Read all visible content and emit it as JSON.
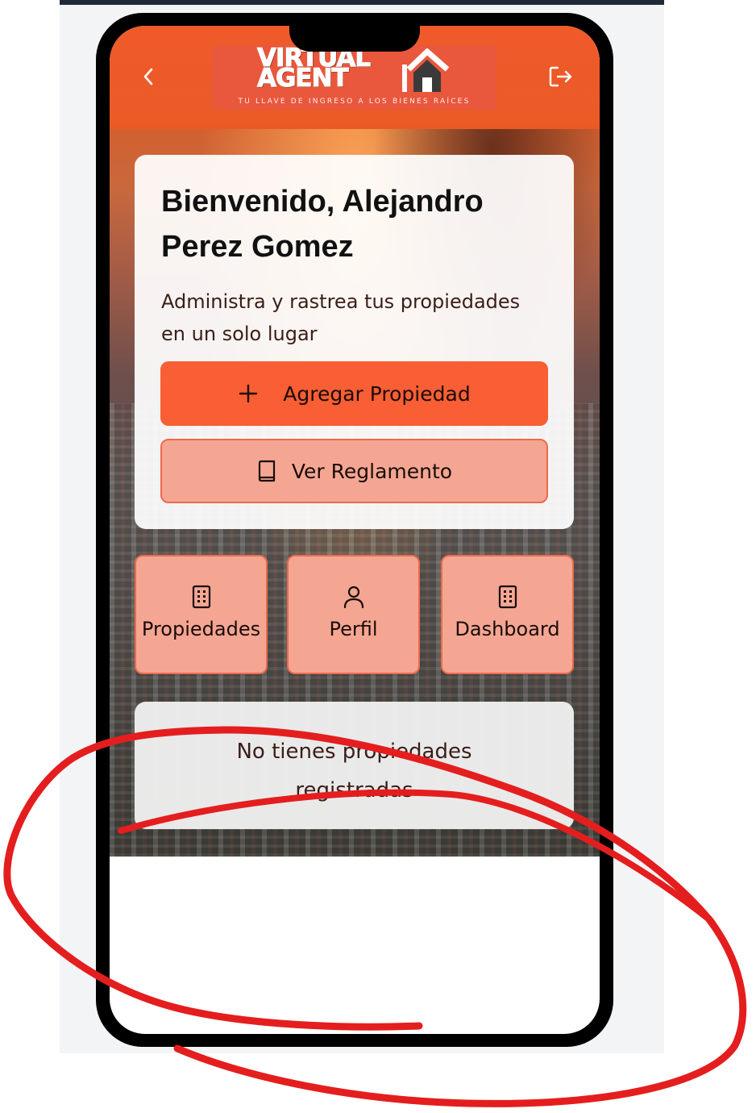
{
  "header": {
    "back_icon": "chevron-left-icon",
    "logout_icon": "logout-icon",
    "logo": {
      "line1": "VIRTUAL",
      "line2": "AGENT",
      "tagline": "TU LLAVE DE INGRESO A LOS BIENES RAÍCES"
    }
  },
  "welcome": {
    "title": "Bienvenido, Alejandro Perez Gomez",
    "subtitle": "Administra y rastrea tus propiedades en un solo lugar",
    "add_button": "Agregar Propiedad",
    "rules_button": "Ver Reglamento"
  },
  "tiles": [
    {
      "label": "Propiedades",
      "icon": "building-icon"
    },
    {
      "label": "Perfil",
      "icon": "user-icon"
    },
    {
      "label": "Dashboard",
      "icon": "building-icon"
    }
  ],
  "empty_state": {
    "message": "No tienes propiedades registradas"
  },
  "colors": {
    "header": "#e95b26",
    "primary": "#f95e35",
    "secondary": "#f4a693",
    "annotation": "#e41e1e"
  }
}
